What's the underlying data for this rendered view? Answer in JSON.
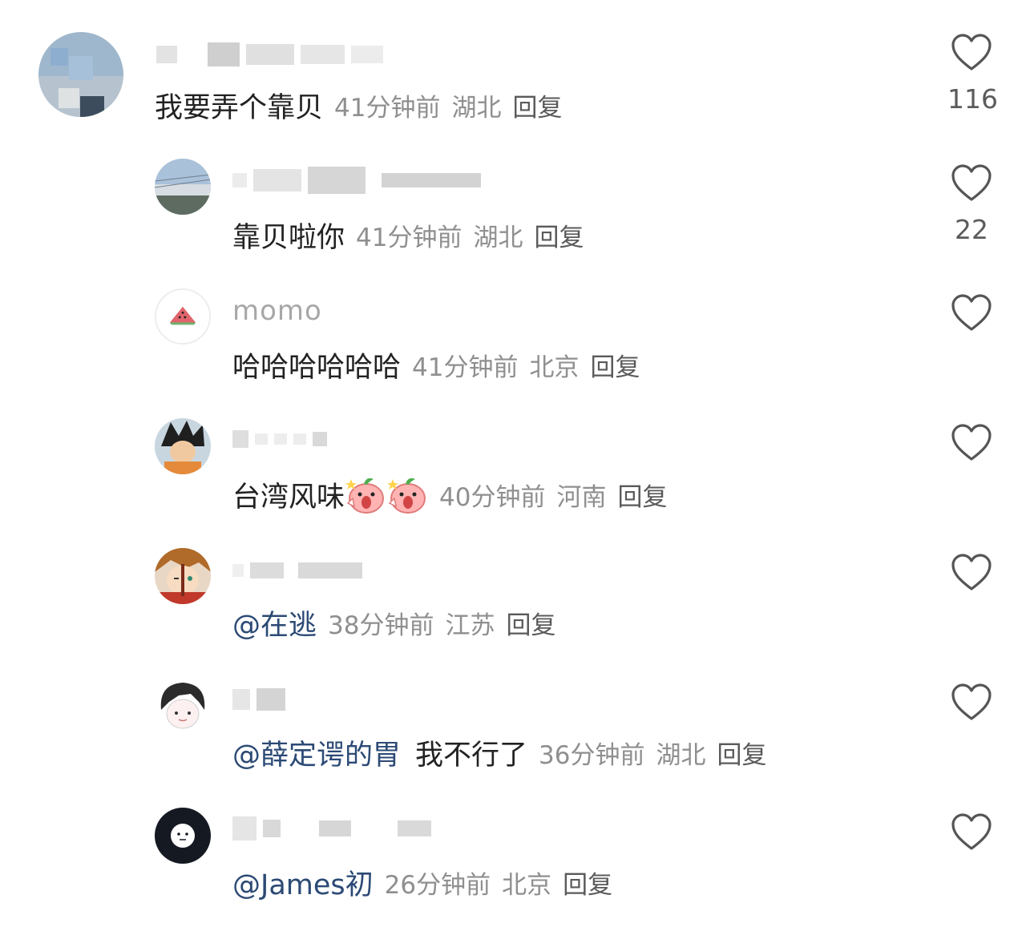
{
  "comments": [
    {
      "text": "我要弄个靠贝",
      "time": "41分钟前",
      "location": "湖北",
      "reply": "回复",
      "likes": "116",
      "icon": "heart-outline-icon"
    },
    {
      "text": "靠贝啦你",
      "time": "41分钟前",
      "location": "湖北",
      "reply": "回复",
      "likes": "22",
      "icon": "heart-outline-icon"
    },
    {
      "username": "momo",
      "text": "哈哈哈哈哈哈",
      "time": "41分钟前",
      "location": "北京",
      "reply": "回复",
      "icon": "heart-outline-icon"
    },
    {
      "text": "台湾风味",
      "emoji": "peach-shock-emoji",
      "time": "40分钟前",
      "location": "河南",
      "reply": "回复",
      "icon": "heart-outline-icon"
    },
    {
      "mention": "@在逃",
      "time": "38分钟前",
      "location": "江苏",
      "reply": "回复",
      "icon": "heart-outline-icon"
    },
    {
      "mention": "@薛定谔的胃",
      "text": "我不行了",
      "time": "36分钟前",
      "location": "湖北",
      "reply": "回复",
      "icon": "heart-outline-icon"
    },
    {
      "mention": "@James初",
      "time": "26分钟前",
      "location": "北京",
      "reply": "回复",
      "icon": "heart-outline-icon"
    }
  ],
  "colors": {
    "mention": "#2c4a75",
    "meta": "#8f8f8f",
    "text": "#222222",
    "heart": "#555555"
  }
}
